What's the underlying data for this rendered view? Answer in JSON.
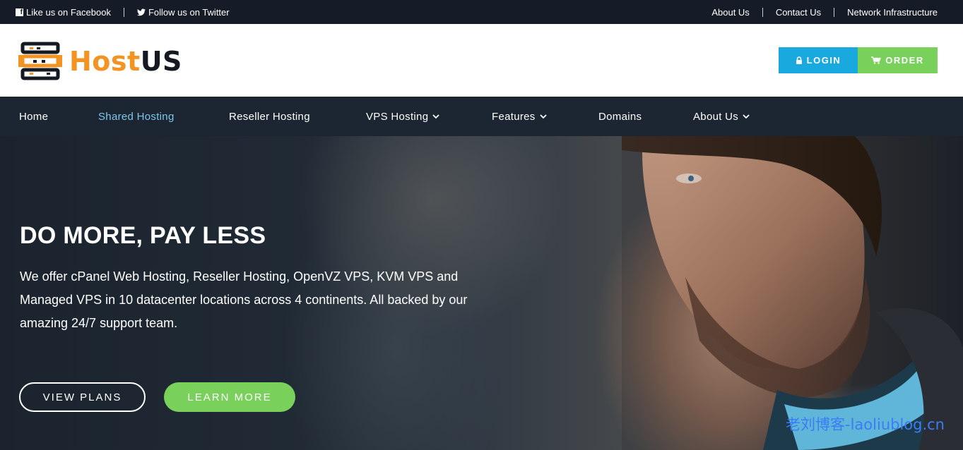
{
  "topbar": {
    "facebook_label": "Like us on Facebook",
    "twitter_label": "Follow us on Twitter",
    "links": [
      "About Us",
      "Contact Us",
      "Network Infrastructure"
    ]
  },
  "header": {
    "logo_host": "Host",
    "logo_us": "US",
    "login_label": "LOGIN",
    "order_label": "ORDER"
  },
  "nav": {
    "items": [
      {
        "label": "Home",
        "dropdown": false,
        "active": false
      },
      {
        "label": "Shared Hosting",
        "dropdown": false,
        "active": true
      },
      {
        "label": "Reseller Hosting",
        "dropdown": false,
        "active": false
      },
      {
        "label": "VPS Hosting",
        "dropdown": true,
        "active": false
      },
      {
        "label": "Features",
        "dropdown": true,
        "active": false
      },
      {
        "label": "Domains",
        "dropdown": false,
        "active": false
      },
      {
        "label": "About Us",
        "dropdown": true,
        "active": false
      }
    ]
  },
  "hero": {
    "title": "DO MORE, PAY LESS",
    "text": "We offer cPanel Web Hosting, Reseller Hosting, OpenVZ VPS, KVM VPS and Managed VPS in 10 datacenter locations across 4 continents. All backed by our amazing 24/7 support team.",
    "view_plans_label": "VIEW PLANS",
    "learn_more_label": "LEARN MORE"
  },
  "watermark": "老刘博客-laoliublog.cn",
  "colors": {
    "topbar_bg": "#161c27",
    "nav_bg": "#1c2532",
    "brand_orange": "#f39322",
    "login_blue": "#19a9df",
    "order_green": "#79d15b",
    "nav_active": "#7cc7ea"
  }
}
